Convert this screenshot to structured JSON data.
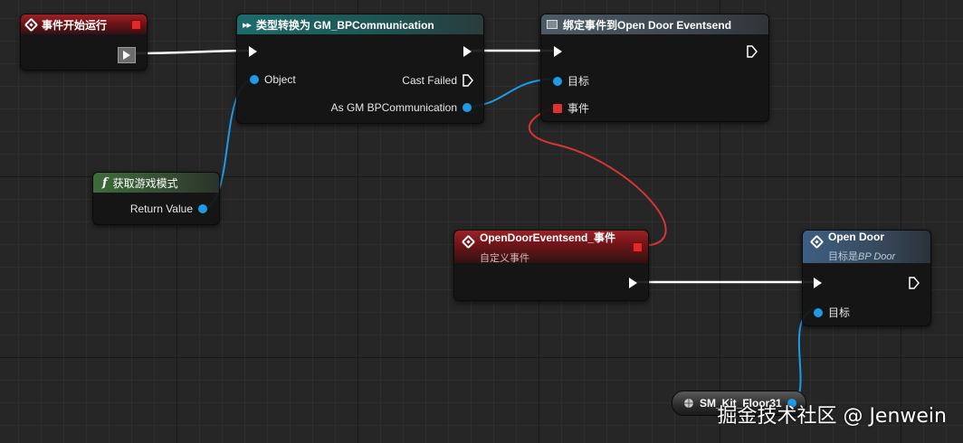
{
  "nodes": {
    "begin_play": {
      "title": "事件开始运行"
    },
    "cast": {
      "title": "类型转换为 GM_BPCommunication",
      "object_pin": "Object",
      "cast_failed_pin": "Cast Failed",
      "as_pin": "As GM BPCommunication"
    },
    "bind": {
      "title": "绑定事件到Open Door Eventsend",
      "target_pin": "目标",
      "event_pin": "事件"
    },
    "get_gamemode": {
      "title": "获取游戏模式",
      "return_pin": "Return Value"
    },
    "custom_event": {
      "title": "OpenDoorEventsend_事件",
      "subtitle": "自定义事件"
    },
    "open_door": {
      "title": "Open Door",
      "subtitle_prefix": "目标是",
      "subtitle_class": "BP Door",
      "target_pin": "目标"
    },
    "variable": {
      "label": "SM_Kit_Floor31"
    }
  },
  "watermark": "掘金技术社区 @ Jenwein",
  "colors": {
    "exec": "#ffffff",
    "object": "#1e9be8",
    "delegate": "#e03030"
  }
}
